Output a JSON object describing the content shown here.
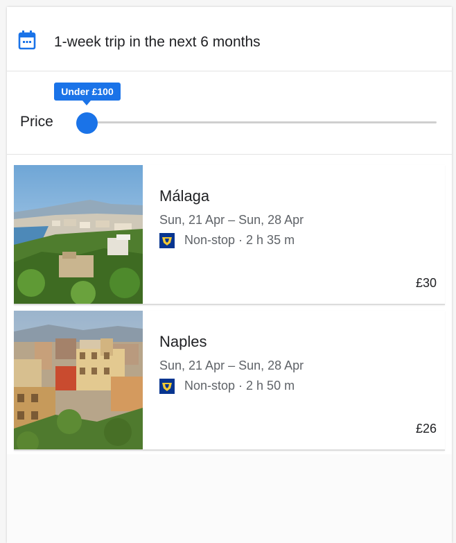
{
  "date_filter": {
    "icon": "calendar-icon",
    "label": "1-week trip in the next 6 months"
  },
  "price_filter": {
    "label": "Price",
    "tooltip": "Under £100",
    "slider_value_fraction": 0.0
  },
  "results": [
    {
      "city": "Málaga",
      "dates": "Sun, 21 Apr – Sun, 28 Apr",
      "airline_icon": "ryanair-logo-icon",
      "flight_info": "Non-stop · 2 h 35 m",
      "price": "£30"
    },
    {
      "city": "Naples",
      "dates": "Sun, 21 Apr – Sun, 28 Apr",
      "airline_icon": "ryanair-logo-icon",
      "flight_info": "Non-stop · 2 h 50 m",
      "price": "£26"
    }
  ],
  "colors": {
    "accent": "#1a73e8",
    "text_primary": "#202124",
    "text_secondary": "#5f6368",
    "airline_brand": "#073590"
  }
}
